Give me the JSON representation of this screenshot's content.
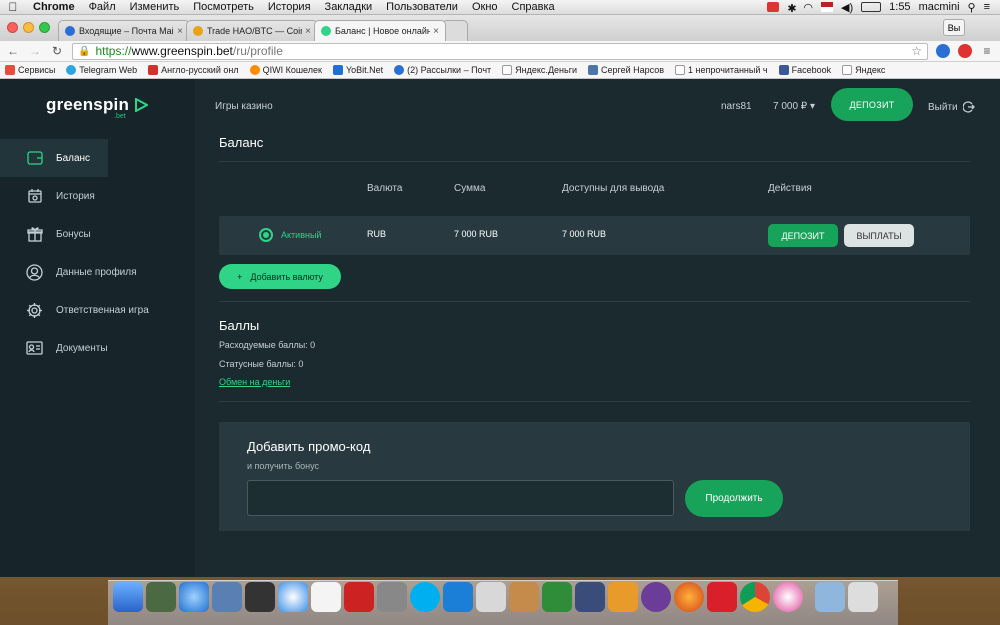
{
  "menubar": {
    "app": "Chrome",
    "items": [
      "Файл",
      "Изменить",
      "Посмотреть",
      "История",
      "Закладки",
      "Пользователи",
      "Окно",
      "Справка"
    ],
    "time": "1:55",
    "user": "macmini"
  },
  "browser": {
    "tabs": [
      {
        "label": "Входящие – Почта Mail.ru",
        "color": "#2a6fd6"
      },
      {
        "label": "Trade HAO/BTC — Coinsb",
        "color": "#e8a317"
      },
      {
        "label": "Баланс | Новое онлайн-к",
        "color": "#2fd487"
      }
    ],
    "window_button": "Вы",
    "url": {
      "scheme": "https://",
      "host": "www.greenspin.bet",
      "path": "/ru/profile"
    },
    "bookmarks": [
      {
        "label": "Сервисы",
        "color": "#e84c3d"
      },
      {
        "label": "Telegram Web",
        "color": "#2ca5e0"
      },
      {
        "label": "Англо-русский онл",
        "color": "#d2322d"
      },
      {
        "label": "QIWI Кошелек",
        "color": "#ff8c00"
      },
      {
        "label": "YoBit.Net",
        "color": "#1e6fd9"
      },
      {
        "label": "(2) Рассылки – Почт",
        "color": "#2a6fd6"
      },
      {
        "label": "Яндекс.Деньги",
        "color": "#999999"
      },
      {
        "label": "Сергей Нарсов",
        "color": "#4a76a8"
      },
      {
        "label": "1 непрочитанный ч",
        "color": "#999999"
      },
      {
        "label": "Facebook",
        "color": "#3b5998"
      },
      {
        "label": "Яндекс",
        "color": "#999999"
      }
    ]
  },
  "site": {
    "logo": "greenspin",
    "logo_sub": ".bet",
    "top_link": "Игры казино",
    "username": "nars81",
    "balance": "7 000 ₽ ▾",
    "deposit_top": "ДЕПОЗИТ",
    "logout": "Выйти",
    "sidebar": [
      {
        "label": "Баланс",
        "icon": "wallet-icon",
        "active": true
      },
      {
        "label": "История",
        "icon": "history-icon",
        "active": false
      },
      {
        "label": "Бонусы",
        "icon": "gift-icon",
        "active": false
      },
      {
        "label": "Данные профиля",
        "icon": "user-icon",
        "active": false
      },
      {
        "label": "Ответственная игра",
        "icon": "settings-icon",
        "active": false
      },
      {
        "label": "Документы",
        "icon": "id-card-icon",
        "active": false
      }
    ]
  },
  "balance": {
    "title": "Баланс",
    "columns": [
      "Валюта",
      "Сумма",
      "Доступны для вывода",
      "Действия"
    ],
    "row": {
      "status": "Активный",
      "currency": "RUB",
      "amount": "7 000 RUB",
      "available": "7 000 RUB",
      "deposit": "ДЕПОЗИТ",
      "withdraw": "ВЫПЛАТЫ"
    },
    "add_currency": "Добавить валюту"
  },
  "points": {
    "title": "Баллы",
    "spendable": "Расходуемые баллы: 0",
    "status": "Статусные баллы: 0",
    "exchange": "Обмен на деньги"
  },
  "promo": {
    "title": "Добавить промо-код",
    "subtitle": "и получить бонус",
    "value": "",
    "button": "Продолжить"
  },
  "colors": {
    "accent": "#2fd487",
    "accent_dark": "#17a35a",
    "bg": "#1b2a2f",
    "panel": "#283a40"
  }
}
